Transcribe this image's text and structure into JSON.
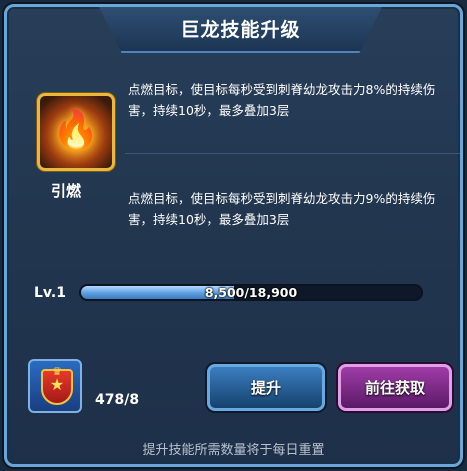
{
  "title": "巨龙技能升级",
  "skill": {
    "name": "引燃",
    "icon": "fire-brazier-icon",
    "current_effect": "点燃目标，使目标每秒受到刺脊幼龙攻击力8%的持续伤害，持续10秒，最多叠加3层",
    "next_effect": "点燃目标，使目标每秒受到刺脊幼龙攻击力9%的持续伤害，持续10秒，最多叠加3层"
  },
  "level": {
    "label": "Lv.1",
    "progress_text": "8,500/18,900",
    "progress_fraction": 0.45
  },
  "item": {
    "icon": "star-shield-badge-icon",
    "count": "478/8"
  },
  "buttons": {
    "upgrade": "提升",
    "go_obtain": "前往获取"
  },
  "footer_note": "提升技能所需数量将于每日重置",
  "colors": {
    "border": "#6aa6d6",
    "upgrade_button": "#2a6aa8",
    "obtain_button": "#8a2e96",
    "progress_fill": "#5c9fe0"
  }
}
